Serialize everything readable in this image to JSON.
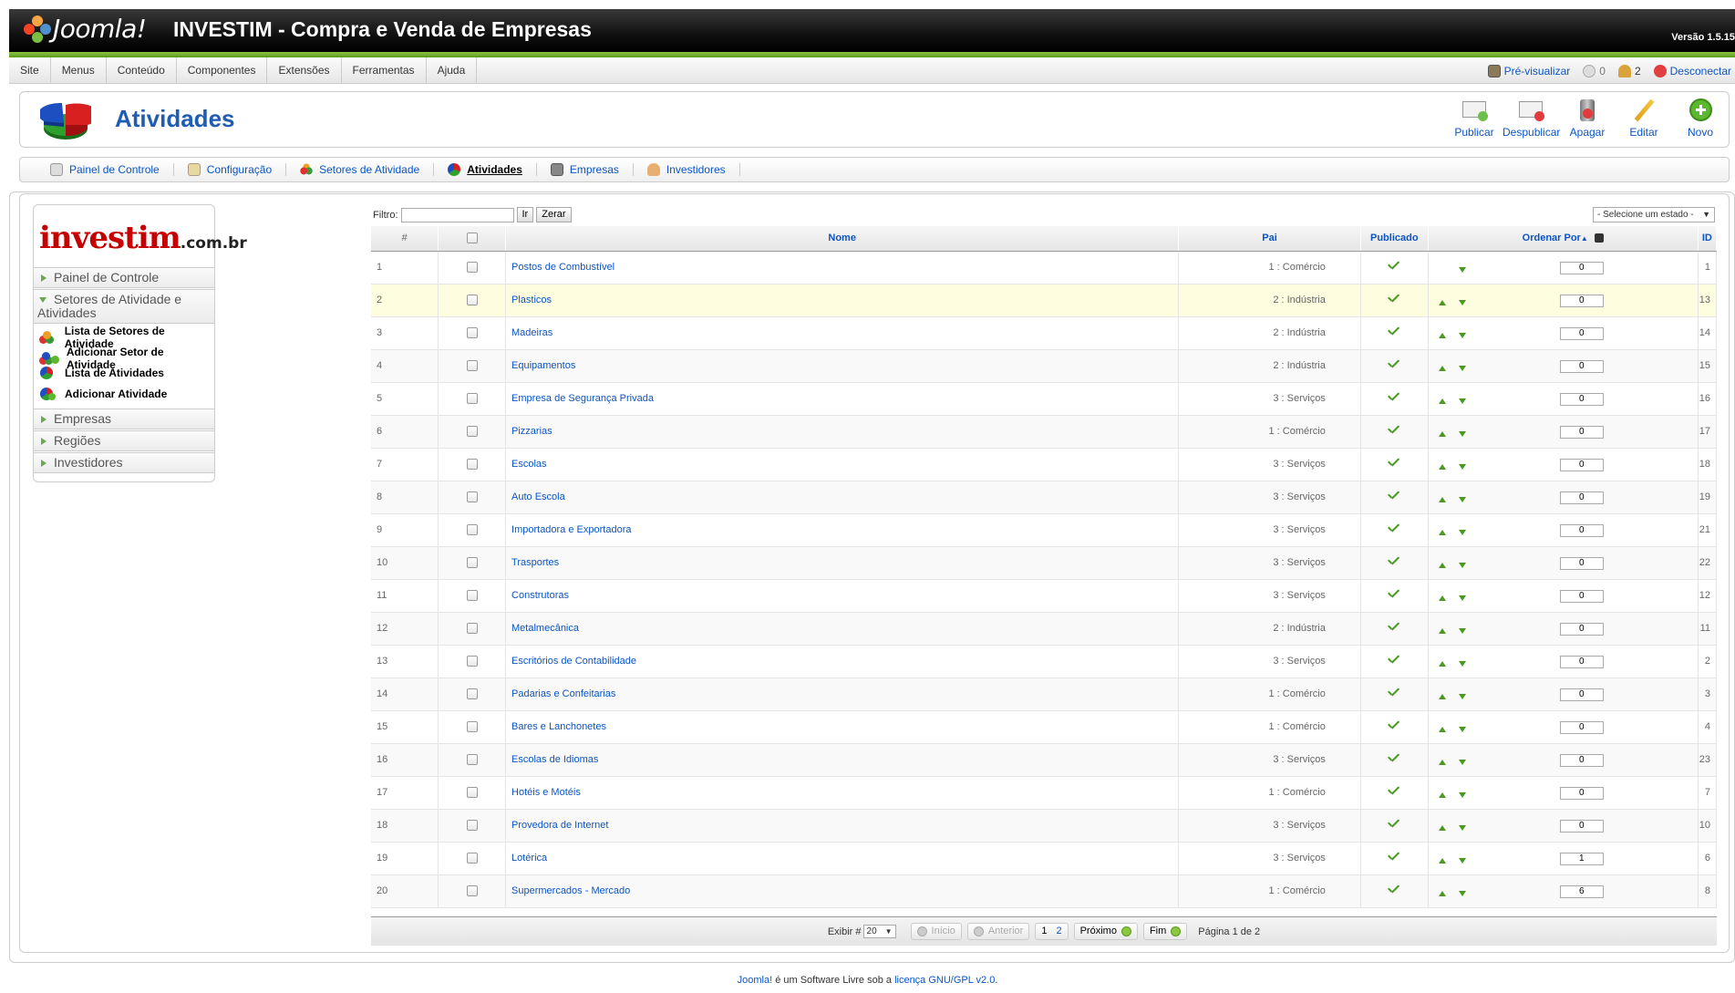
{
  "header": {
    "logo_text": "Joomla!",
    "site_title": "INVESTIM - Compra e Venda de Empresas",
    "version": "Versão 1.5.15"
  },
  "menubar": {
    "items": [
      "Site",
      "Menus",
      "Conteúdo",
      "Componentes",
      "Extensões",
      "Ferramentas",
      "Ajuda"
    ],
    "preview": "Pré-visualizar",
    "messages": "0",
    "users": "2",
    "logout": "Desconectar"
  },
  "toolbar": {
    "page_title": "Atividades",
    "publish": "Publicar",
    "unpublish": "Despublicar",
    "delete": "Apagar",
    "edit": "Editar",
    "new": "Novo"
  },
  "submenu": {
    "items": [
      "Painel de Controle",
      "Configuração",
      "Setores de Atividade",
      "Atividades",
      "Empresas",
      "Investidores"
    ]
  },
  "leftmod": {
    "brand": "investim",
    "brand_suffix": ".com.br",
    "painel": "Painel de Controle",
    "setores": "Setores de Atividade e Atividades",
    "links": [
      "Lista de Setores de Atividade",
      "Adicionar Setor de Atividade",
      "Lista de Atividades",
      "Adicionar Atividade"
    ],
    "empresas": "Empresas",
    "regioes": "Regiões",
    "investidores": "Investidores"
  },
  "filter": {
    "label": "Filtro:",
    "value": "",
    "go": "Ir",
    "reset": "Zerar",
    "state_select": "- Selecione um estado -"
  },
  "table": {
    "headers": {
      "num": "#",
      "nome": "Nome",
      "pai": "Pai",
      "publicado": "Publicado",
      "ordenar": "Ordenar Por",
      "id": "ID"
    },
    "rows": [
      {
        "num": "1",
        "nome": "Postos de Combustível",
        "pai": "1 : Comércio",
        "order": "0",
        "id": "1"
      },
      {
        "num": "2",
        "nome": "Plasticos",
        "pai": "2 : Indústria",
        "order": "0",
        "id": "13"
      },
      {
        "num": "3",
        "nome": "Madeiras",
        "pai": "2 : Indústria",
        "order": "0",
        "id": "14"
      },
      {
        "num": "4",
        "nome": "Equipamentos",
        "pai": "2 : Indústria",
        "order": "0",
        "id": "15"
      },
      {
        "num": "5",
        "nome": "Empresa de Segurança Privada",
        "pai": "3 : Serviços",
        "order": "0",
        "id": "16"
      },
      {
        "num": "6",
        "nome": "Pizzarias",
        "pai": "1 : Comércio",
        "order": "0",
        "id": "17"
      },
      {
        "num": "7",
        "nome": "Escolas",
        "pai": "3 : Serviços",
        "order": "0",
        "id": "18"
      },
      {
        "num": "8",
        "nome": "Auto Escola",
        "pai": "3 : Serviços",
        "order": "0",
        "id": "19"
      },
      {
        "num": "9",
        "nome": "Importadora e Exportadora",
        "pai": "3 : Serviços",
        "order": "0",
        "id": "21"
      },
      {
        "num": "10",
        "nome": "Trasportes",
        "pai": "3 : Serviços",
        "order": "0",
        "id": "22"
      },
      {
        "num": "11",
        "nome": "Construtoras",
        "pai": "3 : Serviços",
        "order": "0",
        "id": "12"
      },
      {
        "num": "12",
        "nome": "Metalmecânica",
        "pai": "2 : Indústria",
        "order": "0",
        "id": "11"
      },
      {
        "num": "13",
        "nome": "Escritórios de Contabilidade",
        "pai": "3 : Serviços",
        "order": "0",
        "id": "2"
      },
      {
        "num": "14",
        "nome": "Padarias e Confeitarias",
        "pai": "1 : Comércio",
        "order": "0",
        "id": "3"
      },
      {
        "num": "15",
        "nome": "Bares e Lanchonetes",
        "pai": "1 : Comércio",
        "order": "0",
        "id": "4"
      },
      {
        "num": "16",
        "nome": "Escolas de Idiomas",
        "pai": "3 : Serviços",
        "order": "0",
        "id": "23"
      },
      {
        "num": "17",
        "nome": "Hotéis e Motéis",
        "pai": "1 : Comércio",
        "order": "0",
        "id": "7"
      },
      {
        "num": "18",
        "nome": "Provedora de Internet",
        "pai": "3 : Serviços",
        "order": "0",
        "id": "10"
      },
      {
        "num": "19",
        "nome": "Lotérica",
        "pai": "3 : Serviços",
        "order": "1",
        "id": "6"
      },
      {
        "num": "20",
        "nome": "Supermercados - Mercado",
        "pai": "1 : Comércio",
        "order": "6",
        "id": "8"
      }
    ]
  },
  "pagination": {
    "show_label": "Exibir #",
    "limit": "20",
    "start": "Início",
    "prev": "Anterior",
    "pages": [
      "1",
      "2"
    ],
    "next": "Próximo",
    "end": "Fim",
    "counter": "Página 1 de 2"
  },
  "footer": {
    "joomla": "Joomla!",
    "text": " é um Software Livre sob a ",
    "license": "licença GNU/GPL v2.0",
    "dot": "."
  }
}
